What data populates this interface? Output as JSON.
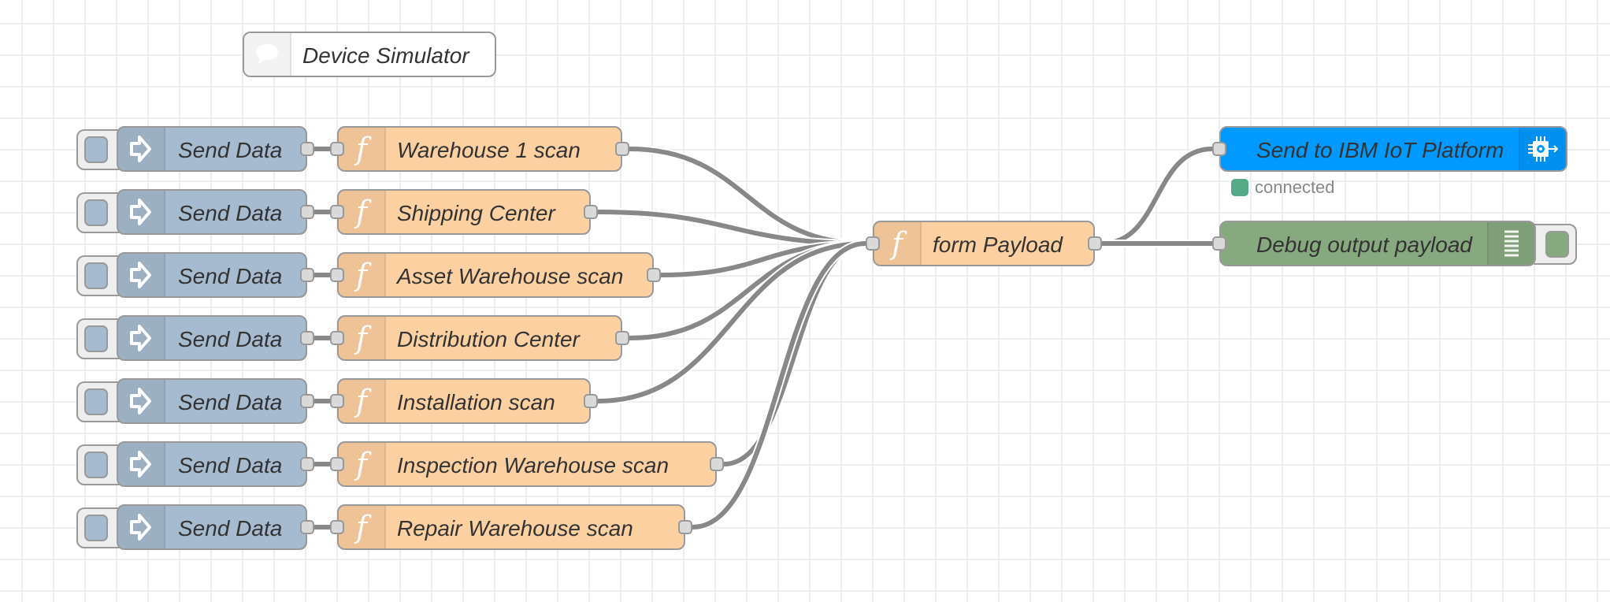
{
  "canvas": {
    "grid": true
  },
  "colors": {
    "inject": "#a6bbcf",
    "function": "#fdd0a2",
    "ibm_iot": "#0099ff",
    "debug": "#87a980",
    "wire": "#888888",
    "status_connected": "#55aa88"
  },
  "comment": {
    "label": "Device Simulator",
    "icon": "comment-icon"
  },
  "rows": [
    {
      "inject": {
        "label": "Send Data",
        "icon": "arrow-in-icon"
      },
      "function": {
        "label": "Warehouse 1 scan",
        "icon": "function-icon"
      }
    },
    {
      "inject": {
        "label": "Send Data",
        "icon": "arrow-in-icon"
      },
      "function": {
        "label": "Shipping Center",
        "icon": "function-icon"
      }
    },
    {
      "inject": {
        "label": "Send Data",
        "icon": "arrow-in-icon"
      },
      "function": {
        "label": "Asset Warehouse scan",
        "icon": "function-icon"
      }
    },
    {
      "inject": {
        "label": "Send Data",
        "icon": "arrow-in-icon"
      },
      "function": {
        "label": "Distribution Center",
        "icon": "function-icon"
      }
    },
    {
      "inject": {
        "label": "Send Data",
        "icon": "arrow-in-icon"
      },
      "function": {
        "label": "Installation scan",
        "icon": "function-icon"
      }
    },
    {
      "inject": {
        "label": "Send Data",
        "icon": "arrow-in-icon"
      },
      "function": {
        "label": "Inspection Warehouse scan",
        "icon": "function-icon"
      }
    },
    {
      "inject": {
        "label": "Send Data",
        "icon": "arrow-in-icon"
      },
      "function": {
        "label": "Repair Warehouse scan",
        "icon": "function-icon"
      }
    }
  ],
  "form_payload": {
    "label": "form Payload",
    "icon": "function-icon"
  },
  "ibm_output": {
    "label": "Send to IBM IoT Platform",
    "icon": "iot-chip-out-icon",
    "status": {
      "text": "connected",
      "state": "connected"
    }
  },
  "debug": {
    "label": "Debug output payload",
    "icon": "debug-list-icon",
    "active": true
  },
  "glyphs": {
    "function": "f"
  }
}
